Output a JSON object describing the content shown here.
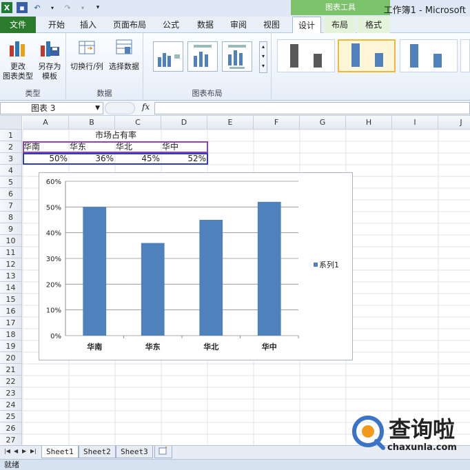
{
  "window": {
    "title": "工作簿1 - Microsoft",
    "context_tab_group": "图表工具"
  },
  "tabs": {
    "file": "文件",
    "home": "开始",
    "insert": "插入",
    "page_layout": "页面布局",
    "formulas": "公式",
    "data": "数据",
    "review": "审阅",
    "view": "视图",
    "design": "设计",
    "layout": "布局",
    "format": "格式"
  },
  "ribbon": {
    "change_chart_type_1": "更改",
    "change_chart_type_2": "图表类型",
    "save_as_template_1": "另存为",
    "save_as_template_2": "模板",
    "group_type": "类型",
    "switch_row_col": "切换行/列",
    "select_data": "选择数据",
    "group_data": "数据",
    "group_layouts": "图表布局"
  },
  "formula_bar": {
    "name_box": "图表 3",
    "fx": "fx",
    "formula": ""
  },
  "columns": [
    "A",
    "B",
    "C",
    "D",
    "E",
    "F",
    "G",
    "H",
    "I",
    "J"
  ],
  "rows": [
    "1",
    "2",
    "3",
    "4",
    "5",
    "6",
    "7",
    "8",
    "9",
    "10",
    "11",
    "12",
    "13",
    "14",
    "15",
    "16",
    "17",
    "18",
    "19",
    "20",
    "21",
    "22",
    "23",
    "24",
    "25",
    "26",
    "27"
  ],
  "cells": {
    "title": "市场占有率",
    "a2": "华南",
    "b2": "华东",
    "c2": "华北",
    "d2": "华中",
    "a3": "50%",
    "b3": "36%",
    "c3": "45%",
    "d3": "52%"
  },
  "chart_data": {
    "type": "bar",
    "categories": [
      "华南",
      "华东",
      "华北",
      "华中"
    ],
    "series": [
      {
        "name": "系列1",
        "values": [
          50,
          36,
          45,
          52
        ]
      }
    ],
    "ylim": [
      0,
      60
    ],
    "yticks": [
      "0%",
      "10%",
      "20%",
      "30%",
      "40%",
      "50%",
      "60%"
    ],
    "grid": true,
    "legend": "right",
    "bar_color": "#4f81bd"
  },
  "sheets": [
    "Sheet1",
    "Sheet2",
    "Sheet3"
  ],
  "status": {
    "ready": "就绪"
  },
  "watermark": {
    "brand": "查询啦",
    "domain": "chaxunla.com"
  }
}
